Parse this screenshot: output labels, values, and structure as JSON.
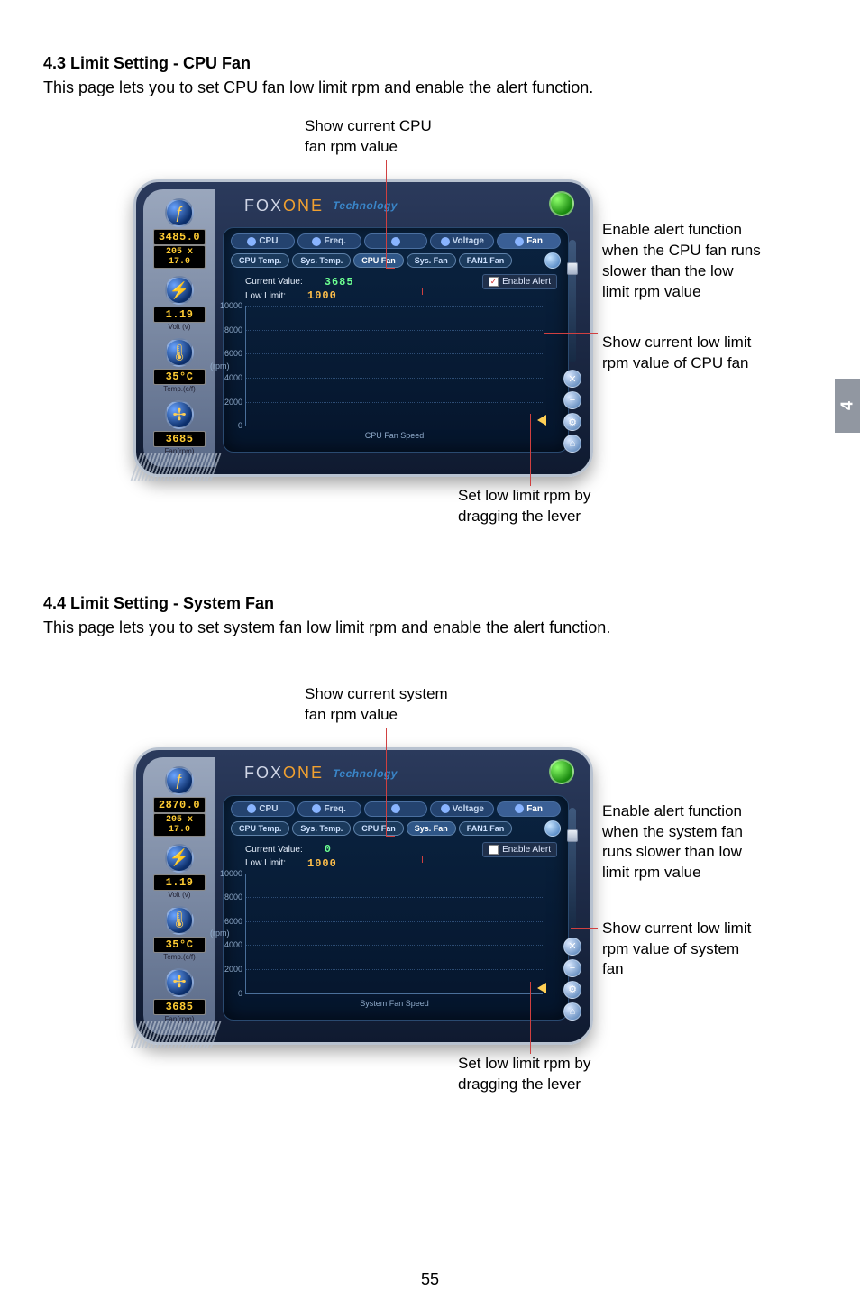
{
  "page_number": "55",
  "chapter_tab": "4",
  "sections": [
    {
      "title": "4.3 Limit Setting - CPU Fan",
      "desc": "This page lets you to set CPU fan low limit rpm and enable the alert function.",
      "callout_top_l1": "Show current CPU",
      "callout_top_l2": "fan rpm value",
      "callout_r1_l1": "Enable alert function",
      "callout_r1_l2": "when the CPU fan runs",
      "callout_r1_l3": "slower than the low",
      "callout_r1_l4": "limit rpm value",
      "callout_r2_l1": "Show current low limit",
      "callout_r2_l2": "rpm value of CPU fan",
      "callout_bot_l1": "Set low limit rpm by",
      "callout_bot_l2": "dragging the lever"
    },
    {
      "title": "4.4 Limit Setting - System Fan",
      "desc": "This page lets you to set system fan low limit rpm and enable the alert function.",
      "callout_top_l1": "Show current system",
      "callout_top_l2": "fan rpm value",
      "callout_r1_l1": "Enable alert function",
      "callout_r1_l2": "when the system fan",
      "callout_r1_l3": "runs slower than low",
      "callout_r1_l4": "limit rpm value",
      "callout_r2_l1": "Show current low limit",
      "callout_r2_l2": "rpm value of system",
      "callout_r2_l3": "fan",
      "callout_bot_l1": "Set low limit rpm by",
      "callout_bot_l2": "dragging the lever"
    }
  ],
  "foxui": {
    "brand_a": "FOX",
    "brand_b": "ONE",
    "tech": "Technology",
    "tabs1": [
      "CPU",
      "Freq.",
      "",
      "Voltage",
      "Fan"
    ],
    "tabs2": [
      "CPU Temp.",
      "Sys. Temp.",
      "CPU Fan",
      "Sys. Fan",
      "FAN1 Fan"
    ],
    "label_current": "Current Value:",
    "label_lowlimit": "Low Limit:",
    "enable_alert": "Enable Alert",
    "y_ticks": [
      "10000",
      "8000",
      "6000",
      "4000",
      "2000",
      "0"
    ],
    "y_axis": "(rpm)"
  },
  "fig1": {
    "side_freq": "3485.0",
    "side_freq_sub": "205 x 17.0",
    "side_volt": "1.19",
    "side_volt_lbl": "Volt (v)",
    "side_temp": "35°C",
    "side_temp_lbl": "Temp.(c/f)",
    "side_fan": "3685",
    "side_fan_lbl": "Fan(rpm)",
    "current_value": "3685",
    "low_limit": "1000",
    "enable_checked": "✓",
    "xlabel": "CPU Fan Speed",
    "active_sub": "CPU Fan"
  },
  "fig2": {
    "side_freq": "2870.0",
    "side_freq_sub": "205 x 17.0",
    "side_volt": "1.19",
    "side_volt_lbl": "Volt (v)",
    "side_temp": "35°C",
    "side_temp_lbl": "Temp.(c/f)",
    "side_fan": "3685",
    "side_fan_lbl": "Fan(rpm)",
    "current_value": "0",
    "low_limit": "1000",
    "enable_checked": "",
    "xlabel": "System Fan Speed",
    "active_sub": "Sys. Fan"
  },
  "chart_data": [
    {
      "type": "line",
      "title": "CPU Fan Speed",
      "ylabel": "(rpm)",
      "ylim": [
        0,
        10000
      ],
      "y_ticks": [
        0,
        2000,
        4000,
        6000,
        8000,
        10000
      ],
      "current_value": 3685,
      "low_limit": 1000
    },
    {
      "type": "line",
      "title": "System Fan Speed",
      "ylabel": "(rpm)",
      "ylim": [
        0,
        10000
      ],
      "y_ticks": [
        0,
        2000,
        4000,
        6000,
        8000,
        10000
      ],
      "current_value": 0,
      "low_limit": 1000
    }
  ]
}
